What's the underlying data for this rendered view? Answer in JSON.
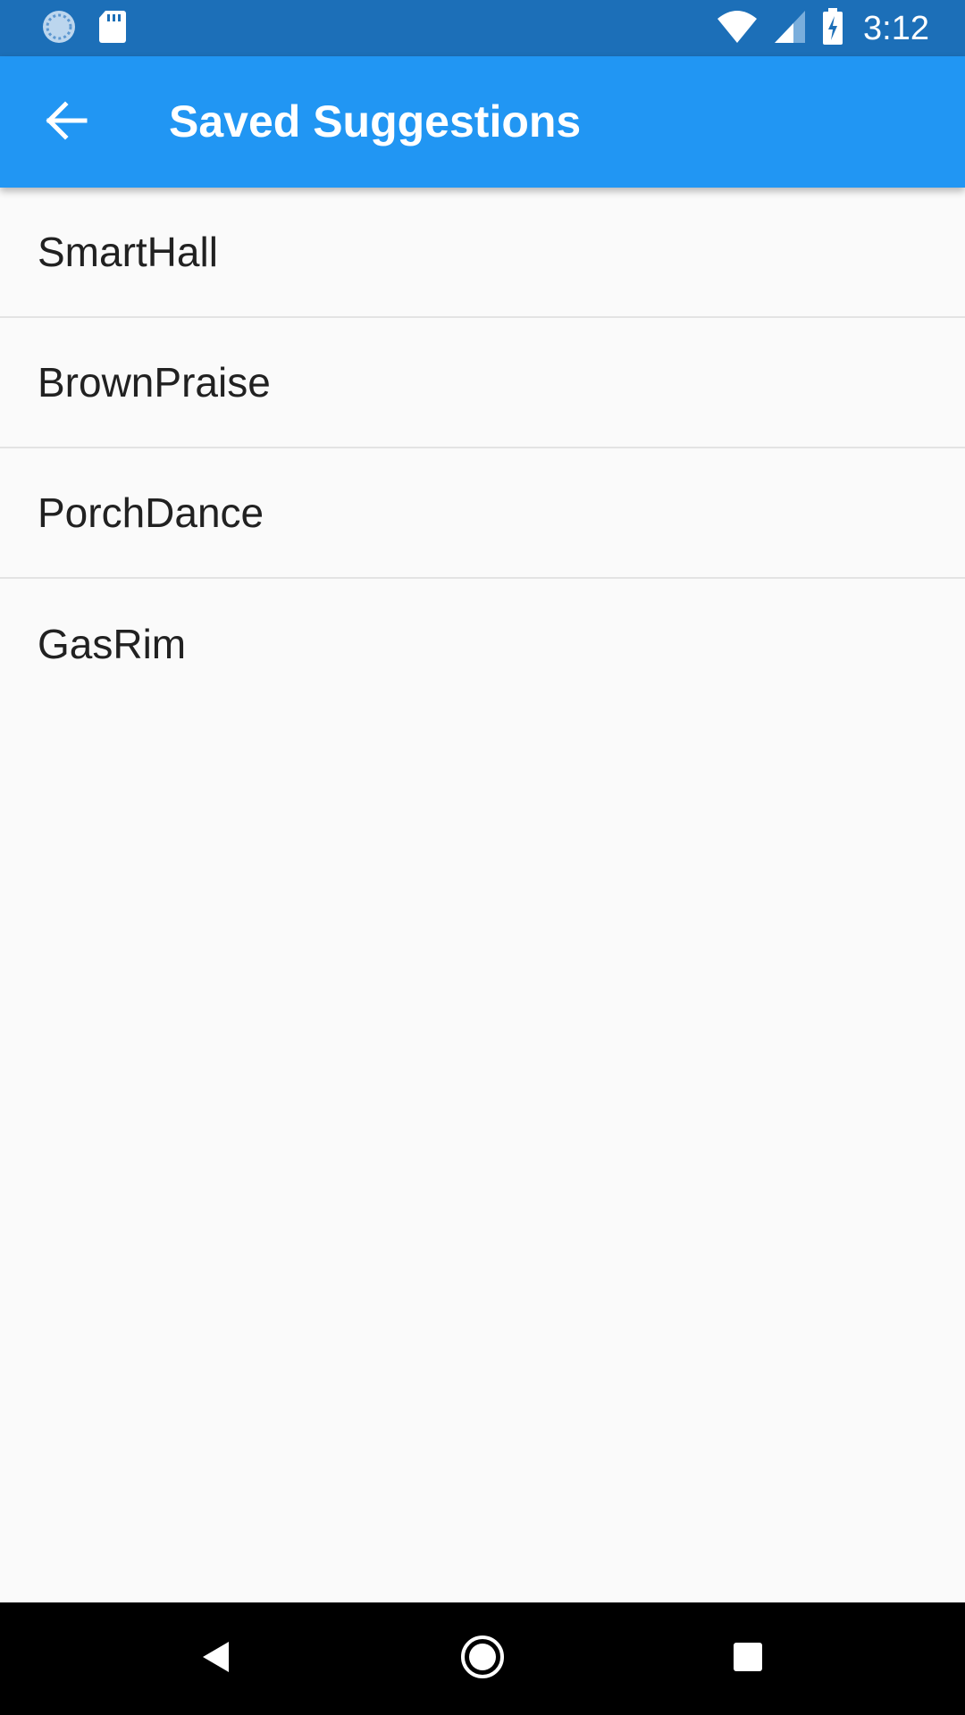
{
  "status_bar": {
    "time": "3:12",
    "left_icons": [
      "sync-progress-icon",
      "sd-card-icon"
    ],
    "right_icons": [
      "wifi-icon",
      "cell-signal-icon",
      "battery-charging-icon"
    ]
  },
  "app_bar": {
    "title": "Saved Suggestions",
    "back_icon": "arrow-back-icon",
    "background_color": "#2196f3"
  },
  "saved_list": {
    "items": [
      {
        "label": "SmartHall"
      },
      {
        "label": "BrownPraise"
      },
      {
        "label": "PorchDance"
      },
      {
        "label": "GasRim"
      }
    ]
  },
  "nav_bar": {
    "buttons": [
      "back-triangle-icon",
      "home-circle-icon",
      "recents-square-icon"
    ]
  },
  "colors": {
    "status_bar": "#1c6fb8",
    "app_bar": "#2196f3",
    "background": "#fafafa",
    "divider": "#e3e3e3",
    "text": "#212121"
  }
}
